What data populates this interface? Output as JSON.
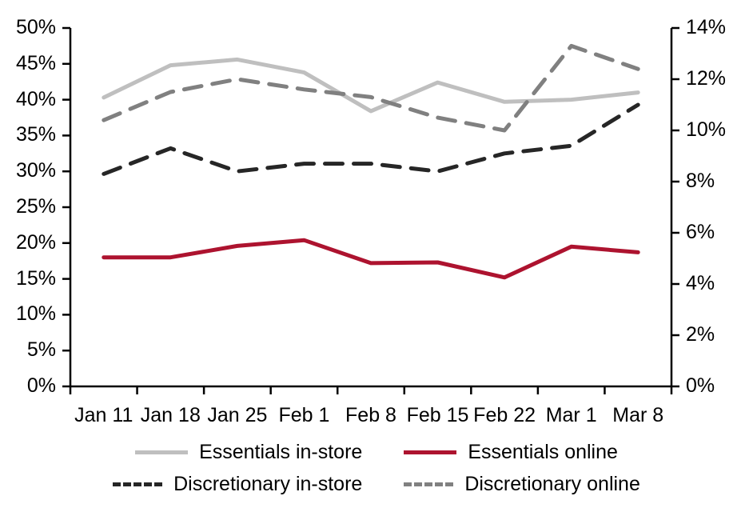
{
  "chart_data": {
    "type": "line",
    "title": "",
    "subtitle": "",
    "xlabel": "",
    "ylabel": "",
    "grid": false,
    "legend_position": "bottom",
    "categories": [
      "Jan 11",
      "Jan 18",
      "Jan 25",
      "Feb 1",
      "Feb 8",
      "Feb 15",
      "Feb 22",
      "Mar 1",
      "Mar 8"
    ],
    "axes": {
      "left": {
        "label": "",
        "ylim": [
          0,
          50
        ],
        "tick_step": 5,
        "tick_labels": [
          "0%",
          "5%",
          "10%",
          "15%",
          "20%",
          "25%",
          "30%",
          "35%",
          "40%",
          "45%",
          "50%"
        ],
        "series": [
          "Essentials in-store",
          "Essentials online"
        ]
      },
      "right": {
        "label": "",
        "ylim": [
          0,
          14
        ],
        "tick_step": 2,
        "tick_labels": [
          "0%",
          "2%",
          "4%",
          "6%",
          "8%",
          "10%",
          "12%",
          "14%"
        ],
        "series": [
          "Discretionary in-store",
          "Discretionary online"
        ]
      }
    },
    "series": [
      {
        "name": "Essentials in-store",
        "axis": "left",
        "color": "#BFBFBF",
        "style": "solid",
        "width": 5,
        "values": [
          40.3,
          44.8,
          45.6,
          43.8,
          38.4,
          42.4,
          39.7,
          40.0,
          41.0
        ]
      },
      {
        "name": "Essentials online",
        "axis": "left",
        "color": "#AD132F",
        "style": "solid",
        "width": 5,
        "values": [
          18.0,
          18.0,
          19.6,
          20.4,
          17.2,
          17.3,
          15.2,
          19.5,
          18.7
        ]
      },
      {
        "name": "Discretionary in-store",
        "axis": "right",
        "color": "#262626",
        "style": "dashed",
        "width": 5,
        "values": [
          8.3,
          9.3,
          8.4,
          8.7,
          8.7,
          8.4,
          9.1,
          9.4,
          11.0
        ]
      },
      {
        "name": "Discretionary online",
        "axis": "right",
        "color": "#808080",
        "style": "dashed",
        "width": 5,
        "values": [
          10.4,
          11.5,
          12.0,
          11.6,
          11.3,
          10.5,
          10.0,
          13.3,
          12.4
        ]
      }
    ]
  },
  "legend": {
    "items": [
      {
        "label": "Essentials in-store",
        "color": "#BFBFBF",
        "style": "solid"
      },
      {
        "label": "Essentials online",
        "color": "#AD132F",
        "style": "solid"
      },
      {
        "label": "Discretionary in-store",
        "color": "#262626",
        "style": "dashed"
      },
      {
        "label": "Discretionary online",
        "color": "#808080",
        "style": "dashed"
      }
    ]
  }
}
